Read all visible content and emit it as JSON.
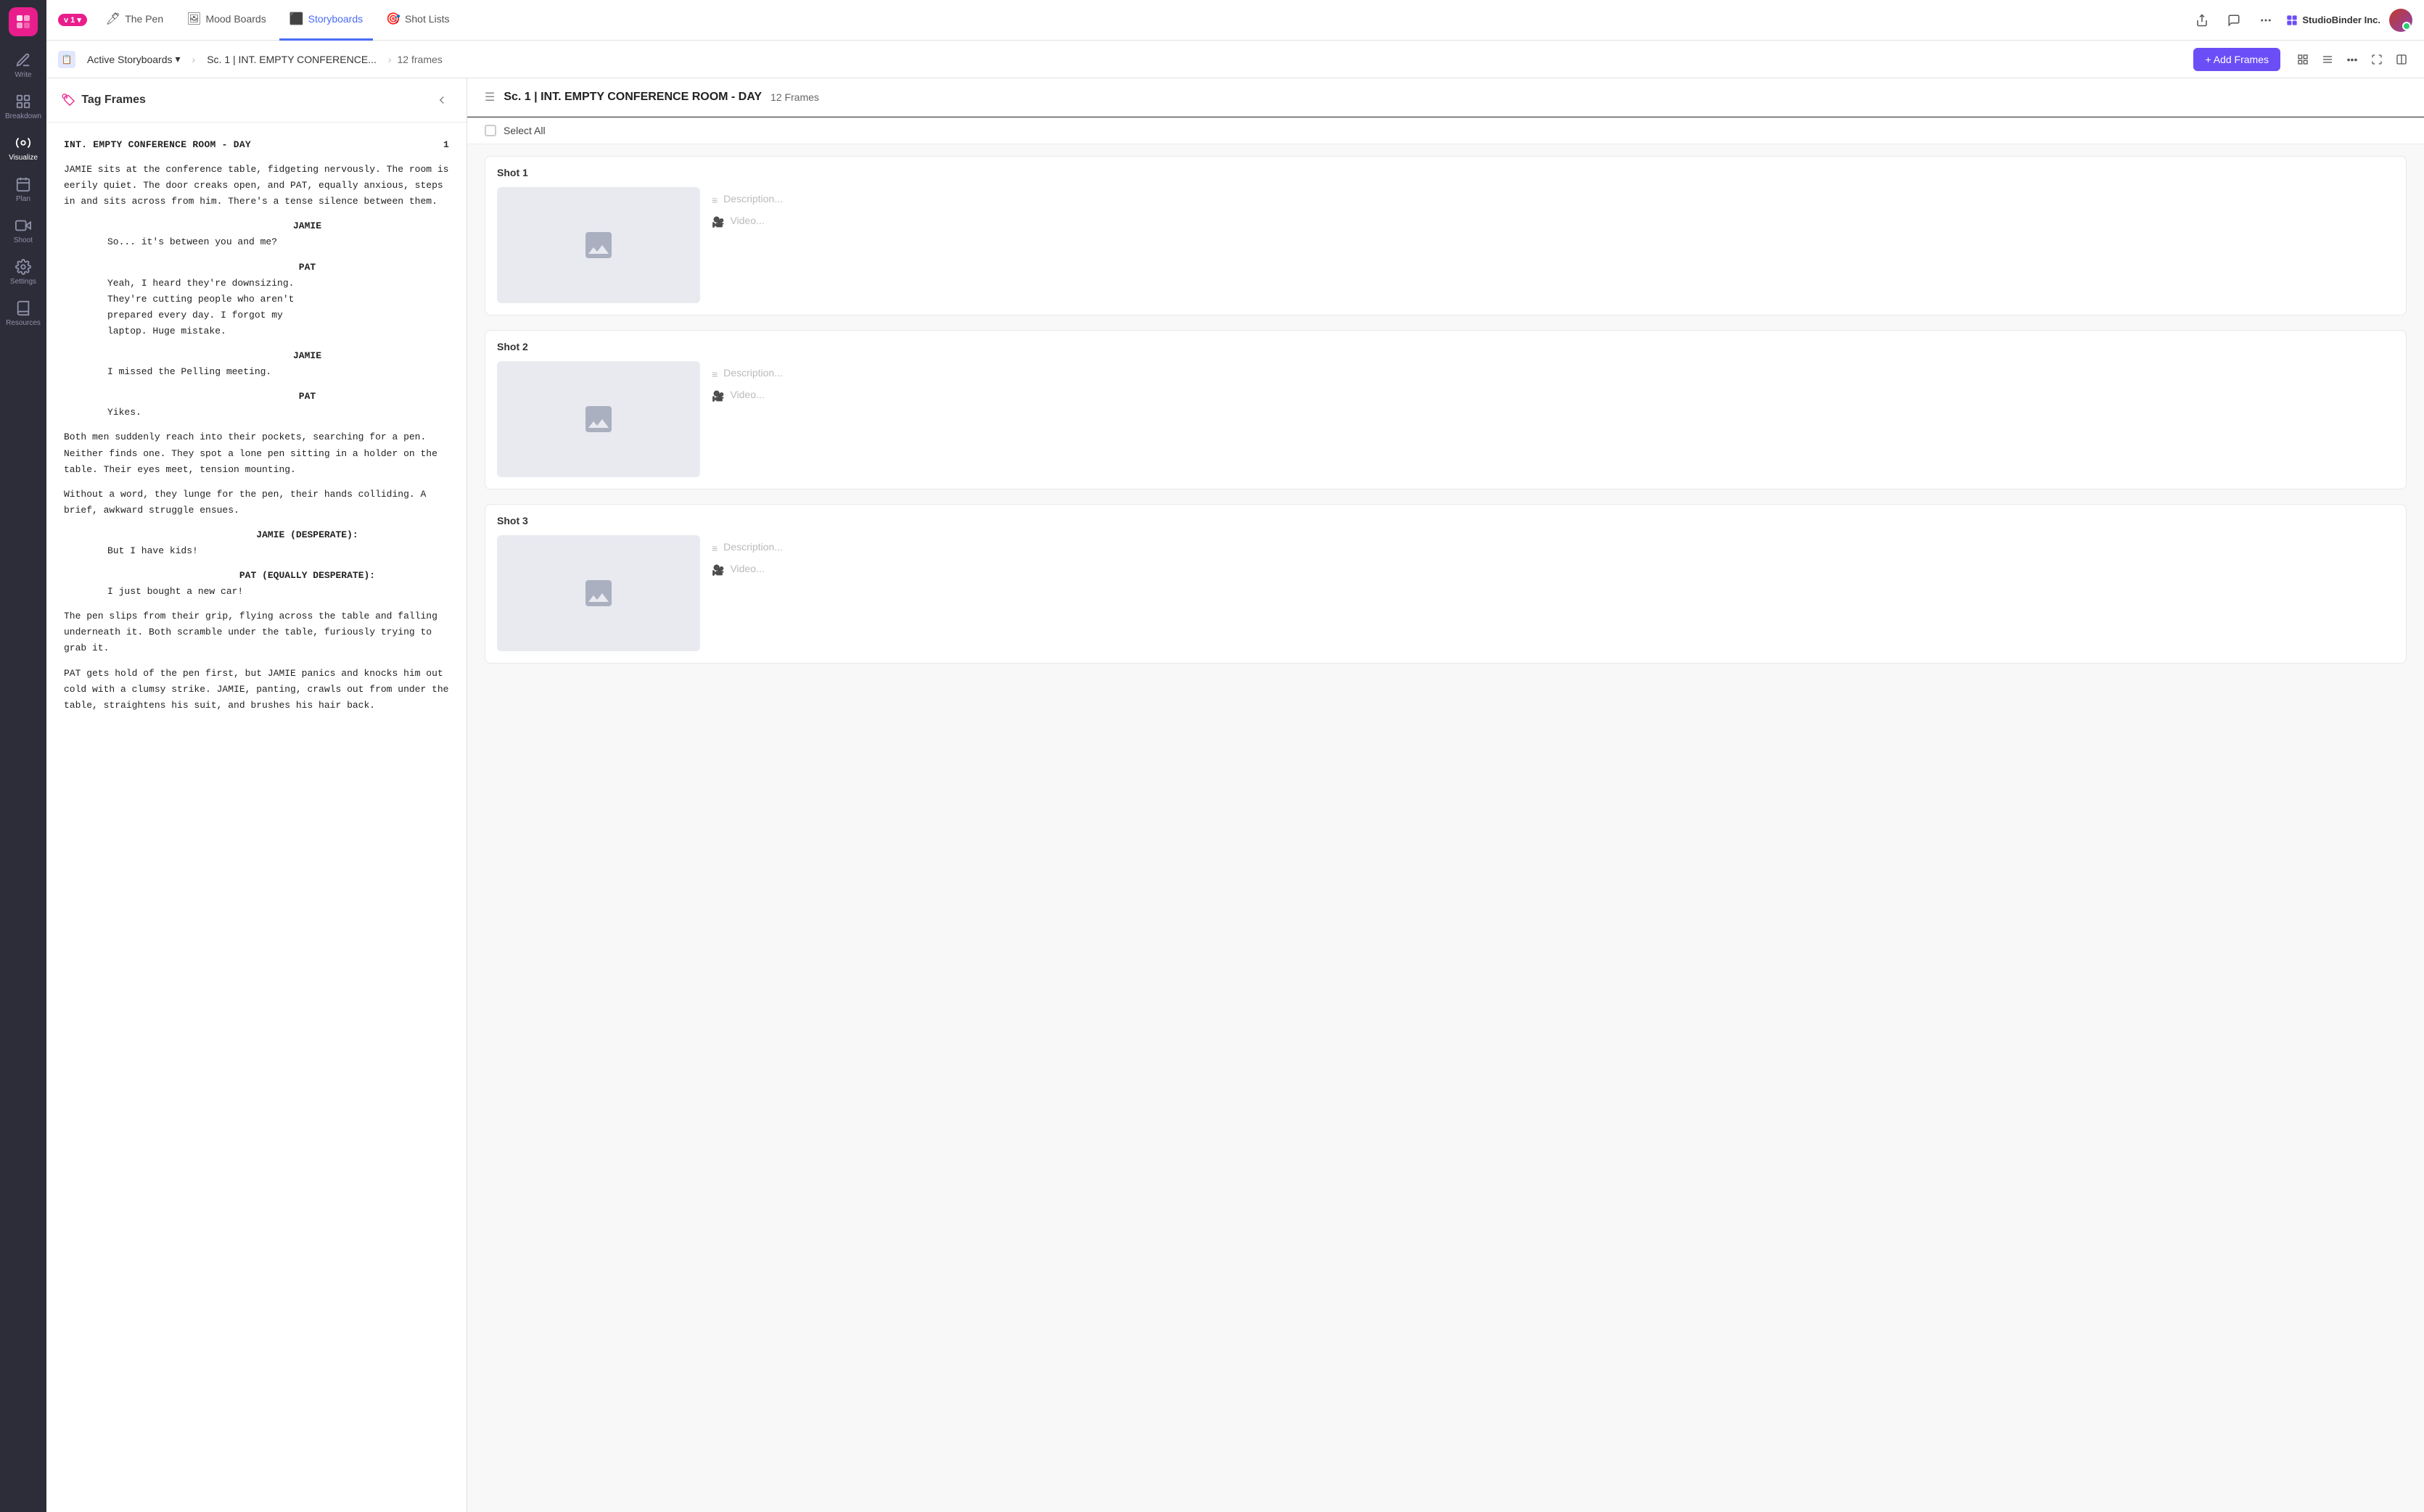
{
  "sidebar": {
    "items": [
      {
        "id": "write",
        "label": "Write",
        "icon": "✏️",
        "active": false
      },
      {
        "id": "breakdown",
        "label": "Breakdown",
        "icon": "📊",
        "active": false
      },
      {
        "id": "visualize",
        "label": "Visualize",
        "icon": "🎨",
        "active": true
      },
      {
        "id": "plan",
        "label": "Plan",
        "icon": "📅",
        "active": false
      },
      {
        "id": "shoot",
        "label": "Shoot",
        "icon": "🎬",
        "active": false
      },
      {
        "id": "settings",
        "label": "Settings",
        "icon": "⚙️",
        "active": false
      },
      {
        "id": "resources",
        "label": "Resources",
        "icon": "📚",
        "active": false
      }
    ]
  },
  "top_nav": {
    "version": "v 1 ▾",
    "tabs": [
      {
        "id": "the-pen",
        "label": "The Pen",
        "active": false
      },
      {
        "id": "mood-boards",
        "label": "Mood Boards",
        "active": false
      },
      {
        "id": "storyboards",
        "label": "Storyboards",
        "active": true
      },
      {
        "id": "shot-lists",
        "label": "Shot Lists",
        "active": false
      }
    ],
    "studio_label": "StudioBinder Inc.",
    "actions": [
      "share",
      "comment",
      "more"
    ]
  },
  "breadcrumb": {
    "icon": "📋",
    "active_section": "Active Storyboards",
    "scene": "Sc. 1 | INT. EMPTY CONFERENCE...",
    "frames_count": "12 frames",
    "add_button": "+ Add Frames"
  },
  "script_panel": {
    "title": "Tag Frames",
    "scene_heading": "INT. EMPTY CONFERENCE ROOM - DAY",
    "scene_number": "1",
    "content": "JAMIE sits at the conference table, fidgeting nervously. The room is eerily quiet. The door creaks open, and PAT, equally anxious, steps in and sits across from him. There's a tense silence between them.",
    "dialogue": [
      {
        "character": "JAMIE",
        "line": "So... it's between you and me?"
      },
      {
        "character": "PAT",
        "line": "Yeah, I heard they're downsizing.\nThey're cutting people who aren't\nprepared every day. I forgot my\nlaptop. Huge mistake."
      },
      {
        "character": "JAMIE",
        "line": "I missed the Pelling meeting."
      },
      {
        "character": "PAT",
        "line": "Yikes."
      }
    ],
    "action2": "Both men suddenly reach into their pockets, searching for a pen. Neither finds one. They spot a lone pen sitting in a holder on the table. Their eyes meet, tension mounting.",
    "action3": "Without a word, they lunge for the pen, their hands colliding. A brief, awkward struggle ensues.",
    "dialogue2": [
      {
        "character": "JAMIE (DESPERATE):",
        "line": "But I have kids!"
      },
      {
        "character": "PAT (EQUALLY DESPERATE):",
        "line": "I just bought a new car!"
      }
    ],
    "action4": "The pen slips from their grip, flying across the table and falling underneath it. Both scramble under the table, furiously trying to grab it.",
    "action5": "PAT gets hold of the pen first, but JAMIE panics and knocks him out cold with a clumsy strike. JAMIE, panting, crawls out from under the table, straightens his suit, and brushes his hair back."
  },
  "frames_panel": {
    "scene_title": "Sc. 1 | INT. EMPTY CONFERENCE ROOM - DAY",
    "frames_count": "12 Frames",
    "select_all": "Select All",
    "shots": [
      {
        "id": 1,
        "label": "Shot  1",
        "description_placeholder": "Description...",
        "video_placeholder": "Video..."
      },
      {
        "id": 2,
        "label": "Shot  2",
        "description_placeholder": "Description...",
        "video_placeholder": "Video..."
      },
      {
        "id": 3,
        "label": "Shot  3",
        "description_placeholder": "Description...",
        "video_placeholder": "Video..."
      }
    ]
  }
}
